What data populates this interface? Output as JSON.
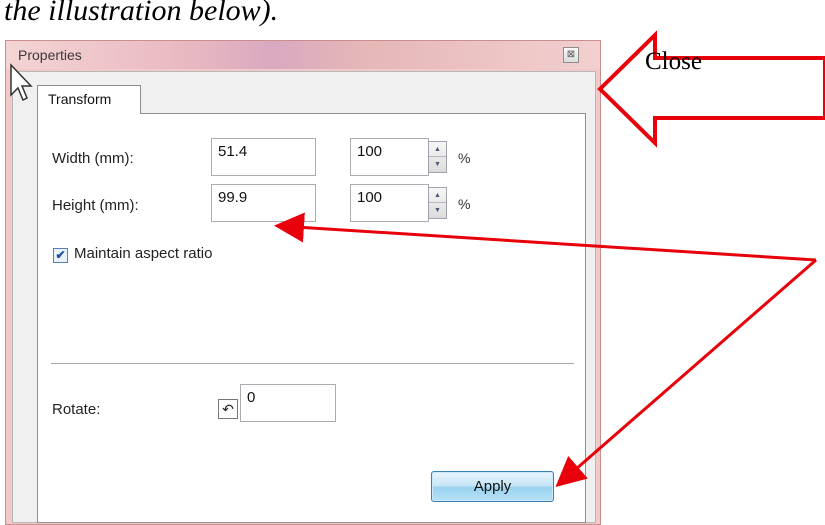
{
  "document": {
    "caption": "the illustration below)."
  },
  "window": {
    "title": "Properties",
    "close_glyph": "⊠"
  },
  "tabs": [
    {
      "label": "Transform"
    }
  ],
  "transform": {
    "width_label": "Width (mm):",
    "width_value": "51.4",
    "width_percent": "100",
    "height_label": "Height (mm):",
    "height_value": "99.9",
    "height_percent": "100",
    "percent_unit": "%",
    "spin_up_glyph": "▲",
    "spin_down_glyph": "▼",
    "aspect_label": "Maintain aspect ratio",
    "aspect_checked": true,
    "check_glyph": "✔",
    "rotate_label": "Rotate:",
    "rotate_icon_glyph": "↶",
    "rotate_value": "0",
    "apply_label": "Apply"
  },
  "annotations": {
    "close_callout_text": "Close",
    "arrow_color": "#e8000b"
  },
  "icons": {
    "close": "close-icon",
    "rotate": "rotate-icon",
    "cursor": "mouse-cursor-icon",
    "spin_up": "spin-up-icon",
    "spin_down": "spin-down-icon",
    "check": "checkmark-icon"
  }
}
